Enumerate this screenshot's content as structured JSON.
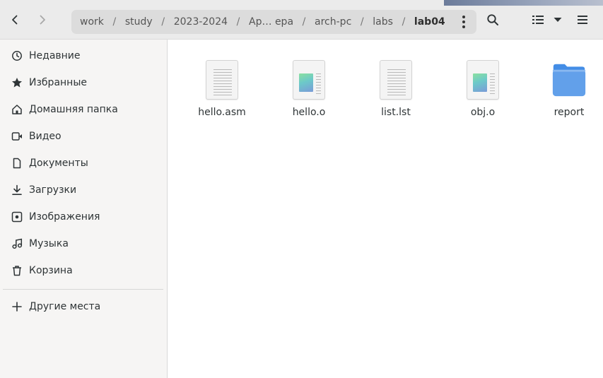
{
  "header": {
    "path": [
      "work",
      "study",
      "2023-2024",
      "Ар… ера",
      "arch-pc",
      "labs",
      "lab04"
    ],
    "separator": "/"
  },
  "sidebar": {
    "items": [
      {
        "label": "Недавние",
        "icon": "clock-icon"
      },
      {
        "label": "Избранные",
        "icon": "star-icon"
      },
      {
        "label": "Домашняя папка",
        "icon": "home-icon"
      },
      {
        "label": "Видео",
        "icon": "video-icon"
      },
      {
        "label": "Документы",
        "icon": "document-icon"
      },
      {
        "label": "Загрузки",
        "icon": "download-icon"
      },
      {
        "label": "Изображения",
        "icon": "image-icon"
      },
      {
        "label": "Музыка",
        "icon": "music-icon"
      },
      {
        "label": "Корзина",
        "icon": "trash-icon"
      }
    ],
    "other_places": {
      "label": "Другие места",
      "icon": "plus-icon"
    }
  },
  "files": [
    {
      "name": "hello.asm",
      "type": "text"
    },
    {
      "name": "hello.o",
      "type": "object"
    },
    {
      "name": "list.lst",
      "type": "text"
    },
    {
      "name": "obj.o",
      "type": "object"
    },
    {
      "name": "report",
      "type": "folder"
    }
  ],
  "colors": {
    "folder": "#62a0ea",
    "folder_tab": "#438de6",
    "headerbar": "#ebebeb",
    "pathbar": "#dcdcdc"
  }
}
